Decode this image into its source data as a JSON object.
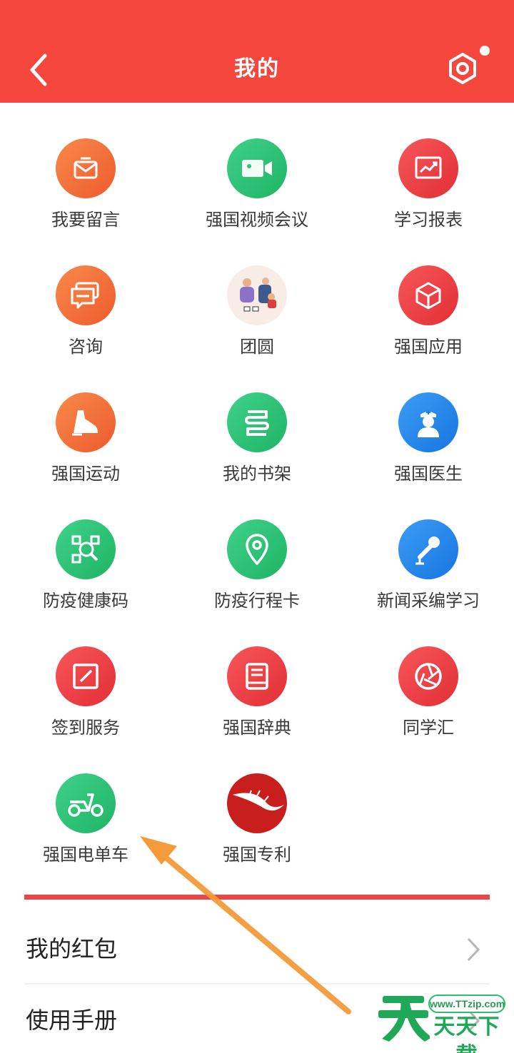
{
  "header": {
    "title": "我的",
    "back_icon": "chevron-left-icon",
    "settings_icon": "hexagon-gear-icon",
    "bg_color": "#f5473d"
  },
  "grid": {
    "items": [
      {
        "label": "我要留言",
        "icon": "message-envelope-icon",
        "color": "orange"
      },
      {
        "label": "强国视频会议",
        "icon": "video-camera-icon",
        "color": "green"
      },
      {
        "label": "学习报表",
        "icon": "chart-report-icon",
        "color": "red"
      },
      {
        "label": "咨询",
        "icon": "chat-bubbles-icon",
        "color": "orange"
      },
      {
        "label": "团圆",
        "icon": "reunion-illustration-icon",
        "color": "cream"
      },
      {
        "label": "强国应用",
        "icon": "cube-icon",
        "color": "red"
      },
      {
        "label": "强国运动",
        "icon": "sneaker-icon",
        "color": "orange"
      },
      {
        "label": "我的书架",
        "icon": "bookshelf-icon",
        "color": "green"
      },
      {
        "label": "强国医生",
        "icon": "doctor-icon",
        "color": "blue"
      },
      {
        "label": "防疫健康码",
        "icon": "qr-scan-icon",
        "color": "green"
      },
      {
        "label": "防疫行程卡",
        "icon": "location-pin-icon",
        "color": "green"
      },
      {
        "label": "新闻采编学习",
        "icon": "microphone-icon",
        "color": "blue"
      },
      {
        "label": "签到服务",
        "icon": "pen-square-icon",
        "color": "red"
      },
      {
        "label": "强国辞典",
        "icon": "dictionary-book-icon",
        "color": "red"
      },
      {
        "label": "同学汇",
        "icon": "aperture-icon",
        "color": "red"
      },
      {
        "label": "强国电单车",
        "icon": "e-scooter-icon",
        "color": "green"
      },
      {
        "label": "强国专利",
        "icon": "patent-logo-icon",
        "color": "patent"
      }
    ]
  },
  "list": {
    "rows": [
      {
        "label": "我的红包"
      },
      {
        "label": "使用手册"
      }
    ]
  },
  "watermark": {
    "url": "www.TTzip.com",
    "title": "天天下载"
  }
}
